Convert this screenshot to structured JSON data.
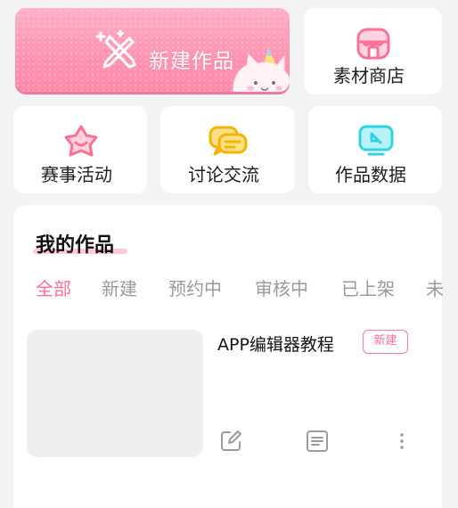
{
  "top": {
    "new_work_label": "新建作品",
    "material_store_label": "素材商店"
  },
  "shortcuts": [
    {
      "label": "赛事活动",
      "icon": "star-crown-icon"
    },
    {
      "label": "讨论交流",
      "icon": "chat-bubbles-icon"
    },
    {
      "label": "作品数据",
      "icon": "monitor-data-icon"
    }
  ],
  "works": {
    "title": "我的作品",
    "tabs": [
      "全部",
      "新建",
      "预约中",
      "审核中",
      "已上架",
      "未"
    ],
    "active_tab": "全部",
    "items": [
      {
        "name": "APP编辑器教程",
        "status": "新建"
      }
    ]
  },
  "colors": {
    "accent_pink": "#ff6f94",
    "hero_pink": "#ff93b2",
    "icon_yellow": "#f5b400",
    "icon_cyan": "#2ed3e6",
    "background": "#f3f3f5"
  }
}
